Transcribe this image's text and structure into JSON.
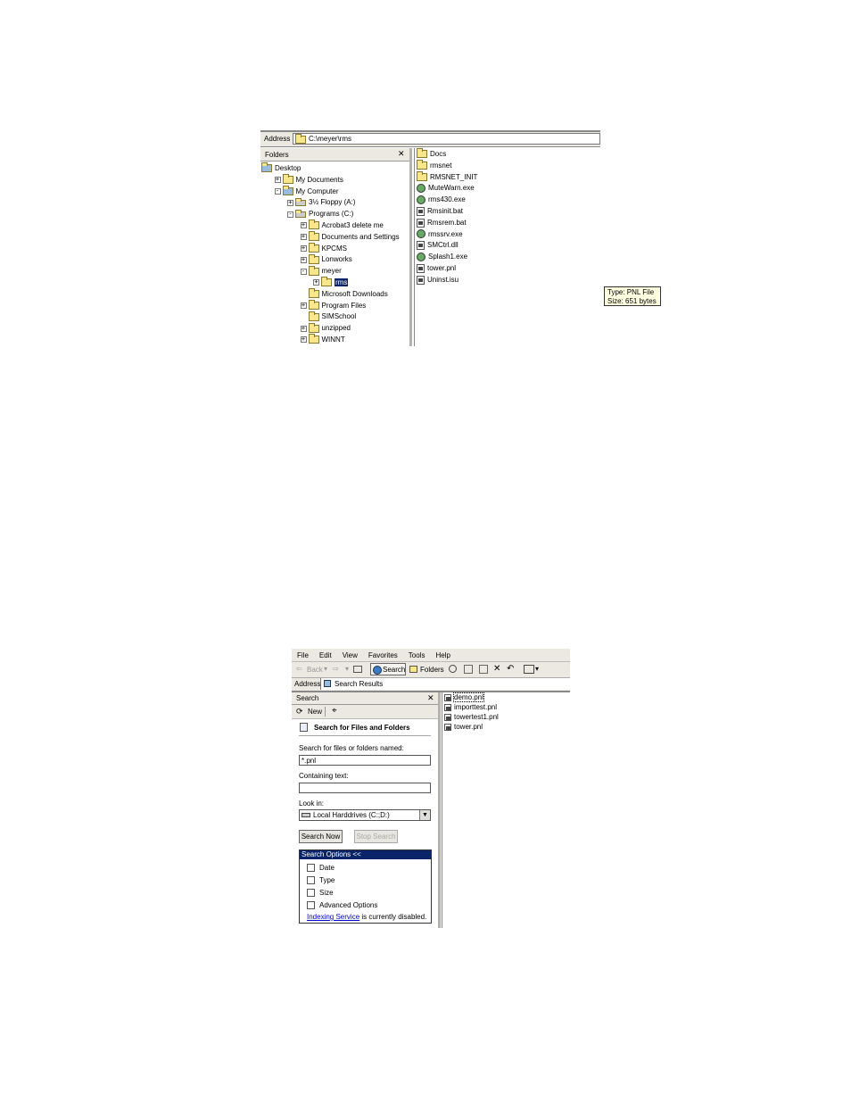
{
  "explorer": {
    "address_label": "Address",
    "address_value": "C:\\meyer\\rms",
    "folders_title": "Folders",
    "close_glyph": "✕",
    "tree": [
      {
        "label": "Desktop",
        "indent": 0,
        "toggle": "",
        "icon": "desktop-icon"
      },
      {
        "label": "My Documents",
        "indent": 1,
        "toggle": "+",
        "icon": "my-documents-icon"
      },
      {
        "label": "My Computer",
        "indent": 1,
        "toggle": "-",
        "icon": "my-computer-icon"
      },
      {
        "label": "3½ Floppy (A:)",
        "indent": 2,
        "toggle": "+",
        "icon": "floppy-icon"
      },
      {
        "label": "Programs (C:)",
        "indent": 2,
        "toggle": "-",
        "icon": "drive-icon"
      },
      {
        "label": "Acrobat3 delete me",
        "indent": 3,
        "toggle": "+",
        "icon": "folder-icon"
      },
      {
        "label": "Documents and Settings",
        "indent": 3,
        "toggle": "+",
        "icon": "folder-icon"
      },
      {
        "label": "KPCMS",
        "indent": 3,
        "toggle": "+",
        "icon": "folder-icon"
      },
      {
        "label": "Lonworks",
        "indent": 3,
        "toggle": "+",
        "icon": "folder-icon"
      },
      {
        "label": "meyer",
        "indent": 3,
        "toggle": "-",
        "icon": "folder-icon"
      },
      {
        "label": "rms",
        "indent": 4,
        "toggle": "+",
        "icon": "folder-open-icon",
        "selected": true
      },
      {
        "label": "Microsoft Downloads",
        "indent": 3,
        "toggle": "",
        "icon": "folder-icon"
      },
      {
        "label": "Program Files",
        "indent": 3,
        "toggle": "+",
        "icon": "folder-icon"
      },
      {
        "label": "SIMSchool",
        "indent": 3,
        "toggle": "",
        "icon": "folder-icon"
      },
      {
        "label": "unzipped",
        "indent": 3,
        "toggle": "+",
        "icon": "folder-icon"
      },
      {
        "label": "WINNT",
        "indent": 3,
        "toggle": "+",
        "icon": "folder-icon"
      }
    ],
    "files": [
      {
        "label": "Docs",
        "icon": "folder-icon"
      },
      {
        "label": "rmsnet",
        "icon": "folder-icon"
      },
      {
        "label": "RMSNET_INIT",
        "icon": "folder-icon"
      },
      {
        "label": "MuteWarn.exe",
        "icon": "exe-icon"
      },
      {
        "label": "rms430.exe",
        "icon": "exe-icon"
      },
      {
        "label": "Rmsinit.bat",
        "icon": "batch-icon"
      },
      {
        "label": "Rmsrem.bat",
        "icon": "batch-icon"
      },
      {
        "label": "rmssrv.exe",
        "icon": "exe-icon"
      },
      {
        "label": "SMCtrl.dll",
        "icon": "dll-icon"
      },
      {
        "label": "Splash1.exe",
        "icon": "exe-icon"
      },
      {
        "label": "tower.pnl",
        "icon": "pnl-file-icon"
      },
      {
        "label": "Uninst.isu",
        "icon": "file-icon"
      }
    ],
    "tooltip": {
      "type_line": "Type: PNL File",
      "size_line": "Size: 651 bytes"
    }
  },
  "search": {
    "menu": [
      "File",
      "Edit",
      "View",
      "Favorites",
      "Tools",
      "Help"
    ],
    "toolbar": {
      "back": "Back",
      "search": "Search",
      "folders": "Folders"
    },
    "address_label": "Address",
    "address_value": "Search Results",
    "pane_title": "Search",
    "close_glyph": "✕",
    "new_label": "New",
    "heading": "Search for Files and Folders",
    "named_label": "Search for files or folders named:",
    "named_value": "*.pnl",
    "containing_label": "Containing text:",
    "containing_value": "",
    "lookin_label": "Look in:",
    "lookin_value": "Local Harddrives (C:;D:)",
    "search_now": "Search Now",
    "stop_search": "Stop Search",
    "options_title": "Search Options <<",
    "options": [
      "Date",
      "Type",
      "Size",
      "Advanced Options"
    ],
    "indexing_link": "Indexing Service",
    "indexing_text": " is currently disabled.",
    "results": [
      "demo.pnl",
      "importtest.pnl",
      "towertest1.pnl",
      "tower.pnl"
    ]
  }
}
